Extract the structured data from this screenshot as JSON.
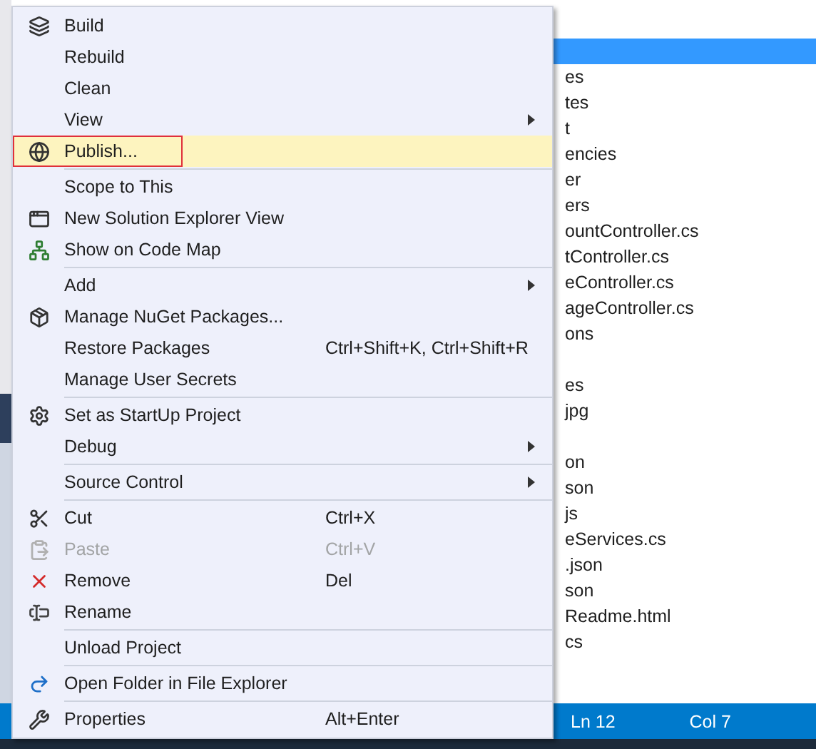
{
  "menu": {
    "items": [
      {
        "kind": "item",
        "label": "Build",
        "submenu": false,
        "disabled": false,
        "selected": false,
        "outlined": false
      },
      {
        "kind": "item",
        "label": "Rebuild",
        "submenu": false,
        "disabled": false,
        "selected": false,
        "outlined": false
      },
      {
        "kind": "item",
        "label": "Clean",
        "submenu": false,
        "disabled": false,
        "selected": false,
        "outlined": false
      },
      {
        "kind": "item",
        "label": "View",
        "submenu": true,
        "disabled": false,
        "selected": false,
        "outlined": false
      },
      {
        "kind": "item",
        "label": "Publish...",
        "submenu": false,
        "disabled": false,
        "selected": true,
        "outlined": true
      },
      {
        "kind": "separator"
      },
      {
        "kind": "item",
        "label": "Scope to This",
        "submenu": false,
        "disabled": false,
        "selected": false,
        "outlined": false
      },
      {
        "kind": "item",
        "label": "New Solution Explorer View",
        "submenu": false,
        "disabled": false,
        "selected": false,
        "outlined": false
      },
      {
        "kind": "item",
        "label": "Show on Code Map",
        "submenu": false,
        "disabled": false,
        "selected": false,
        "outlined": false
      },
      {
        "kind": "separator"
      },
      {
        "kind": "item",
        "label": "Add",
        "submenu": true,
        "disabled": false,
        "selected": false,
        "outlined": false
      },
      {
        "kind": "item",
        "label": "Manage NuGet Packages...",
        "submenu": false,
        "disabled": false,
        "selected": false,
        "outlined": false
      },
      {
        "kind": "item",
        "label": "Restore Packages",
        "shortcut": "Ctrl+Shift+K, Ctrl+Shift+R",
        "submenu": false,
        "disabled": false,
        "selected": false,
        "outlined": false
      },
      {
        "kind": "item",
        "label": "Manage User Secrets",
        "submenu": false,
        "disabled": false,
        "selected": false,
        "outlined": false
      },
      {
        "kind": "separator"
      },
      {
        "kind": "item",
        "label": "Set as StartUp Project",
        "submenu": false,
        "disabled": false,
        "selected": false,
        "outlined": false
      },
      {
        "kind": "item",
        "label": "Debug",
        "submenu": true,
        "disabled": false,
        "selected": false,
        "outlined": false
      },
      {
        "kind": "separator"
      },
      {
        "kind": "item",
        "label": "Source Control",
        "submenu": true,
        "disabled": false,
        "selected": false,
        "outlined": false
      },
      {
        "kind": "separator"
      },
      {
        "kind": "item",
        "label": "Cut",
        "shortcut": "Ctrl+X",
        "submenu": false,
        "disabled": false,
        "selected": false,
        "outlined": false
      },
      {
        "kind": "item",
        "label": "Paste",
        "shortcut": "Ctrl+V",
        "submenu": false,
        "disabled": true,
        "selected": false,
        "outlined": false
      },
      {
        "kind": "item",
        "label": "Remove",
        "shortcut": "Del",
        "submenu": false,
        "disabled": false,
        "selected": false,
        "outlined": false
      },
      {
        "kind": "item",
        "label": "Rename",
        "submenu": false,
        "disabled": false,
        "selected": false,
        "outlined": false
      },
      {
        "kind": "separator"
      },
      {
        "kind": "item",
        "label": "Unload Project",
        "submenu": false,
        "disabled": false,
        "selected": false,
        "outlined": false
      },
      {
        "kind": "separator"
      },
      {
        "kind": "item",
        "label": "Open Folder in File Explorer",
        "submenu": false,
        "disabled": false,
        "selected": false,
        "outlined": false
      },
      {
        "kind": "separator"
      },
      {
        "kind": "item",
        "label": "Properties",
        "shortcut": "Alt+Enter",
        "submenu": false,
        "disabled": false,
        "selected": false,
        "outlined": false
      }
    ]
  },
  "explorer": {
    "rows": [
      {
        "label": "",
        "selected": true
      },
      {
        "label": "es",
        "selected": false
      },
      {
        "label": "tes",
        "selected": false
      },
      {
        "label": "t",
        "selected": false
      },
      {
        "label": "encies",
        "selected": false
      },
      {
        "label": "er",
        "selected": false
      },
      {
        "label": "ers",
        "selected": false
      },
      {
        "label": "ountController.cs",
        "selected": false
      },
      {
        "label": "tController.cs",
        "selected": false
      },
      {
        "label": "eController.cs",
        "selected": false
      },
      {
        "label": "ageController.cs",
        "selected": false
      },
      {
        "label": "ons",
        "selected": false
      },
      {
        "label": "",
        "selected": false
      },
      {
        "label": "es",
        "selected": false
      },
      {
        "label": "jpg",
        "selected": false
      },
      {
        "label": "",
        "selected": false
      },
      {
        "label": "on",
        "selected": false
      },
      {
        "label": "son",
        "selected": false
      },
      {
        "label": "js",
        "selected": false
      },
      {
        "label": "eServices.cs",
        "selected": false
      },
      {
        "label": ".json",
        "selected": false
      },
      {
        "label": "son",
        "selected": false
      },
      {
        "label": "Readme.html",
        "selected": false
      },
      {
        "label": "cs",
        "selected": false
      }
    ]
  },
  "status_bar": {
    "line": "Ln 12",
    "column": "Col 7"
  }
}
